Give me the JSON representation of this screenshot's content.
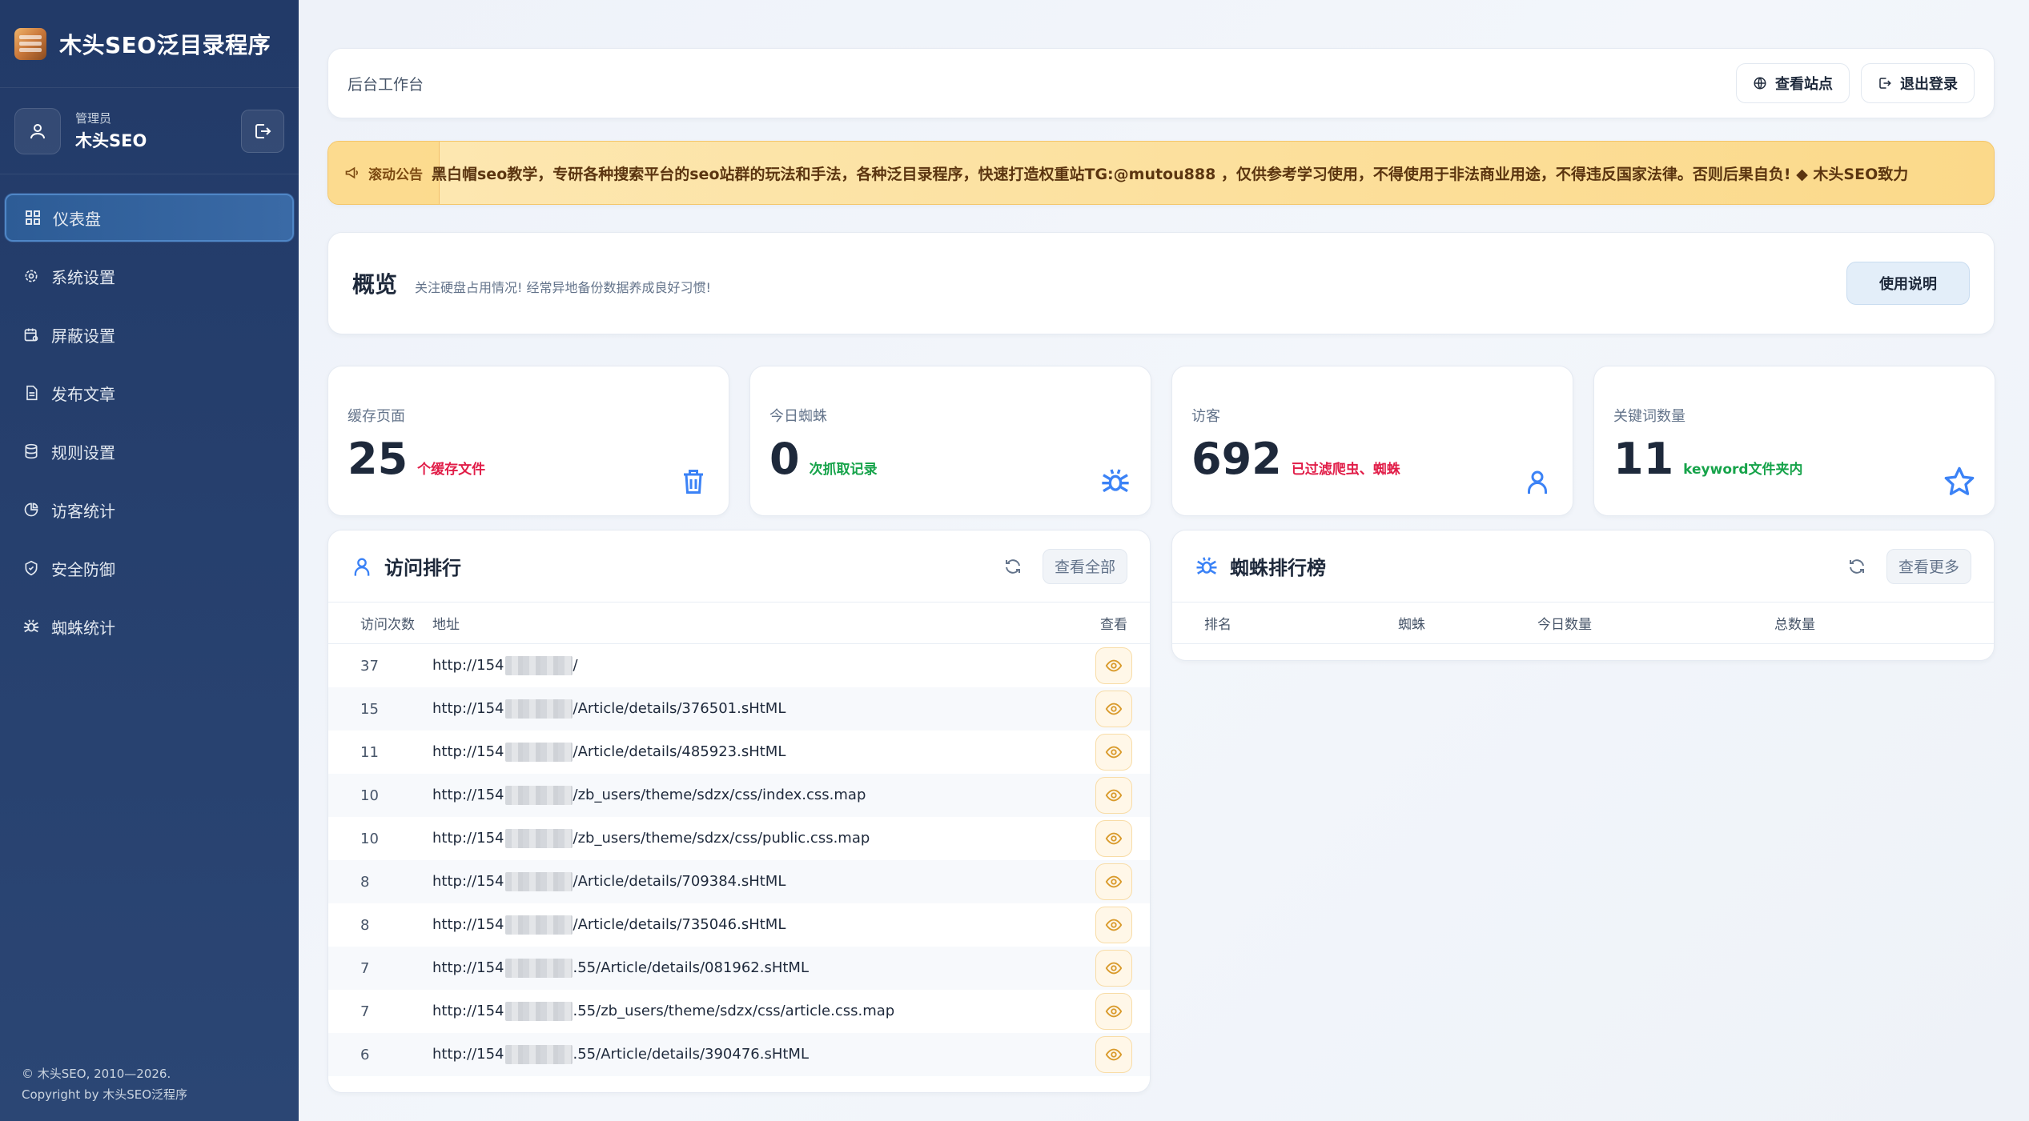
{
  "brand": {
    "title": "木头SEO泛目录程序"
  },
  "user": {
    "role": "管理员",
    "name": "木头SEO"
  },
  "nav": [
    {
      "label": "仪表盘",
      "icon": "grid-icon",
      "active": true
    },
    {
      "label": "系统设置",
      "icon": "gear-icon"
    },
    {
      "label": "屏蔽设置",
      "icon": "calendar-block-icon"
    },
    {
      "label": "发布文章",
      "icon": "document-icon"
    },
    {
      "label": "规则设置",
      "icon": "database-icon"
    },
    {
      "label": "访客统计",
      "icon": "pie-chart-icon"
    },
    {
      "label": "安全防御",
      "icon": "shield-icon"
    },
    {
      "label": "蜘蛛统计",
      "icon": "spider-icon"
    }
  ],
  "footer": {
    "line1": "© 木头SEO, 2010—2026.",
    "line2": "Copyright by 木头SEO泛程序"
  },
  "topbar": {
    "crumb": "后台工作台",
    "view_site": "查看站点",
    "logout": "退出登录"
  },
  "notice": {
    "label": "滚动公告",
    "text": "黑白帽seo教学，专研各种搜索平台的seo站群的玩法和手法，各种泛目录程序，快速打造权重站TG:@mutou888 ，仅供参考学习使用，不得使用于非法商业用途，不得违反国家法律。否则后果自负!  ◆  木头SEO致力"
  },
  "overview": {
    "title": "概览",
    "subtitle": "关注硬盘占用情况! 经常异地备份数据养成良好习惯!",
    "help": "使用说明"
  },
  "stats": [
    {
      "label": "缓存页面",
      "value": "25",
      "note": "个缓存文件",
      "note_color": "#e11d48",
      "icon": "trash-icon",
      "icon_color": "#3b82f6"
    },
    {
      "label": "今日蜘蛛",
      "value": "0",
      "note": "次抓取记录",
      "note_color": "#16a34a",
      "icon": "spider-icon",
      "icon_color": "#3b82f6"
    },
    {
      "label": "访客",
      "value": "692",
      "note": "已过滤爬虫、蜘蛛",
      "note_color": "#e11d48",
      "icon": "user-icon",
      "icon_color": "#3b82f6"
    },
    {
      "label": "关键词数量",
      "value": "11",
      "note": "keyword文件夹内",
      "note_color": "#16a34a",
      "icon": "star-icon",
      "icon_color": "#3b82f6"
    }
  ],
  "visits": {
    "title": "访问排行",
    "more": "查看全部",
    "columns": [
      "访问次数",
      "地址",
      "查看"
    ],
    "rows": [
      {
        "count": "37",
        "prefix": "http://154",
        "path": "/"
      },
      {
        "count": "15",
        "prefix": "http://154",
        "path": "/Article/details/376501.sHtML"
      },
      {
        "count": "11",
        "prefix": "http://154",
        "path": "/Article/details/485923.sHtML"
      },
      {
        "count": "10",
        "prefix": "http://154",
        "path": "/zb_users/theme/sdzx/css/index.css.map"
      },
      {
        "count": "10",
        "prefix": "http://154",
        "path": "/zb_users/theme/sdzx/css/public.css.map"
      },
      {
        "count": "8",
        "prefix": "http://154",
        "path": "/Article/details/709384.sHtML"
      },
      {
        "count": "8",
        "prefix": "http://154",
        "path": "/Article/details/735046.sHtML"
      },
      {
        "count": "7",
        "prefix": "http://154",
        "path": ".55/Article/details/081962.sHtML"
      },
      {
        "count": "7",
        "prefix": "http://154",
        "path": ".55/zb_users/theme/sdzx/css/article.css.map"
      },
      {
        "count": "6",
        "prefix": "http://154",
        "path": ".55/Article/details/390476.sHtML"
      }
    ]
  },
  "spiders": {
    "title": "蜘蛛排行榜",
    "more": "查看更多",
    "columns": [
      "排名",
      "蜘蛛",
      "今日数量",
      "总数量"
    ]
  }
}
